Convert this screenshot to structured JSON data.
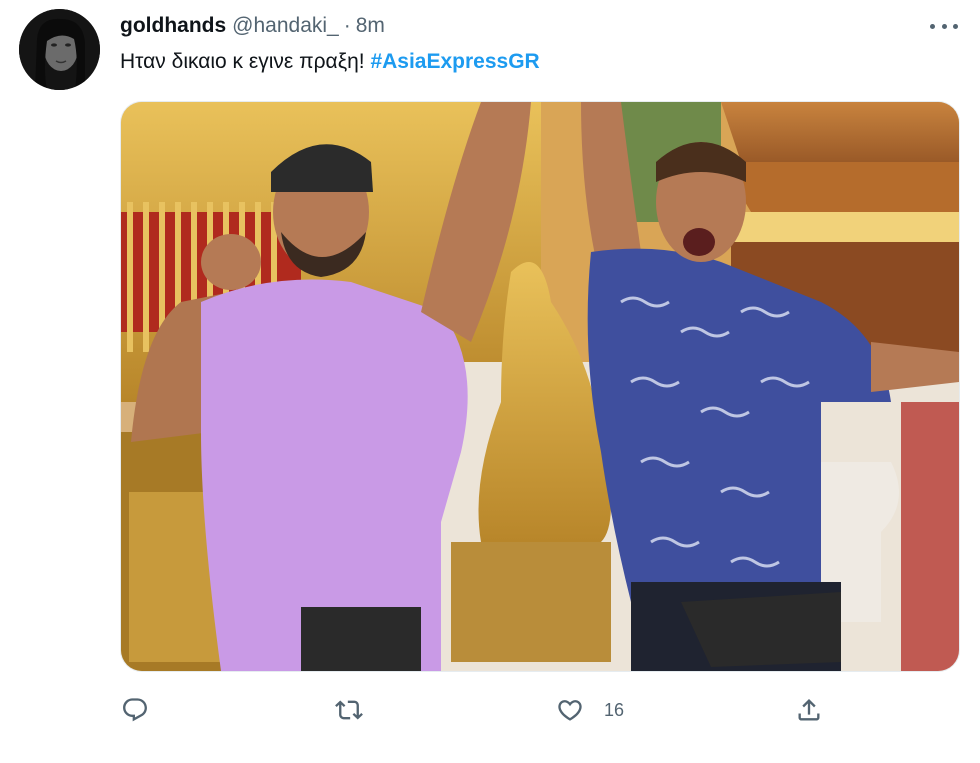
{
  "tweet": {
    "display_name": "goldhands",
    "handle": "@handaki_",
    "separator": "·",
    "time": "8m",
    "text": "Ηταν δικαιο κ εγινε πραξη!",
    "hashtag": "#AsiaExpressGR"
  },
  "actions": {
    "reply_icon": "reply-icon",
    "retweet_icon": "retweet-icon",
    "like_icon": "heart-icon",
    "like_count": "16",
    "share_icon": "share-icon"
  },
  "colors": {
    "hashtag": "#1d9bf0",
    "secondary_text": "#536471"
  }
}
